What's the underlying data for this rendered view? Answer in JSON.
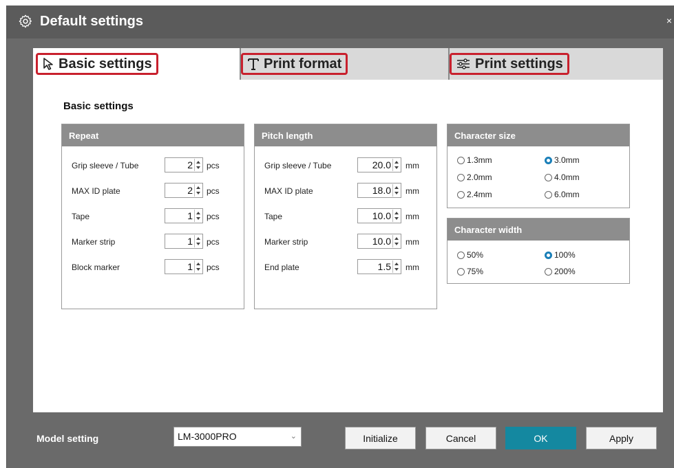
{
  "window": {
    "title": "Default settings",
    "close_symbol": "×"
  },
  "tabs": [
    {
      "label": "Basic settings",
      "icon": "cursor-arrow-icon",
      "active": true
    },
    {
      "label": "Print format",
      "icon": "text-t-icon",
      "active": false
    },
    {
      "label": "Print settings",
      "icon": "sliders-icon",
      "active": false
    }
  ],
  "content": {
    "section_title": "Basic settings",
    "repeat": {
      "header": "Repeat",
      "rows": [
        {
          "label": "Grip sleeve / Tube",
          "value": "2",
          "unit": "pcs"
        },
        {
          "label": "MAX ID plate",
          "value": "2",
          "unit": "pcs"
        },
        {
          "label": "Tape",
          "value": "1",
          "unit": "pcs"
        },
        {
          "label": "Marker strip",
          "value": "1",
          "unit": "pcs"
        },
        {
          "label": "Block marker",
          "value": "1",
          "unit": "pcs"
        }
      ]
    },
    "pitch": {
      "header": "Pitch length",
      "rows": [
        {
          "label": "Grip sleeve / Tube",
          "value": "20.0",
          "unit": "mm"
        },
        {
          "label": "MAX ID plate",
          "value": "18.0",
          "unit": "mm"
        },
        {
          "label": "Tape",
          "value": "10.0",
          "unit": "mm"
        },
        {
          "label": "Marker strip",
          "value": "10.0",
          "unit": "mm"
        },
        {
          "label": "End plate",
          "value": "1.5",
          "unit": "mm"
        }
      ]
    },
    "char_size": {
      "header": "Character size",
      "options": [
        "1.3mm",
        "3.0mm",
        "2.0mm",
        "4.0mm",
        "2.4mm",
        "6.0mm"
      ],
      "selected": "3.0mm"
    },
    "char_width": {
      "header": "Character width",
      "options": [
        "50%",
        "100%",
        "75%",
        "200%"
      ],
      "selected": "100%"
    }
  },
  "footer": {
    "model_label": "Model setting",
    "model_value": "LM-3000PRO",
    "buttons": {
      "initialize": "Initialize",
      "cancel": "Cancel",
      "ok": "OK",
      "apply": "Apply"
    }
  },
  "colors": {
    "accent": "#1488a0",
    "highlight": "#c8202d",
    "header_gray": "#8d8d8d"
  }
}
